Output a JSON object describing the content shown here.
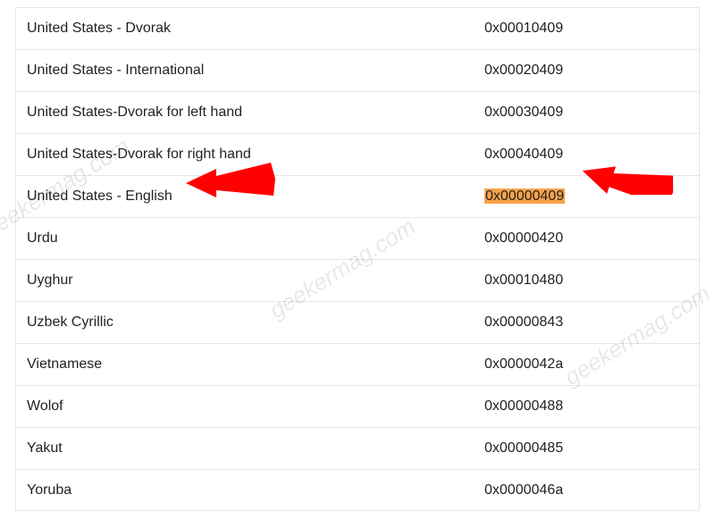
{
  "table": {
    "rows": [
      {
        "name": "United States - Dvorak",
        "code": "0x00010409",
        "highlighted": false
      },
      {
        "name": "United States - International",
        "code": "0x00020409",
        "highlighted": false
      },
      {
        "name": "United States-Dvorak for left hand",
        "code": "0x00030409",
        "highlighted": false
      },
      {
        "name": "United States-Dvorak for right hand",
        "code": "0x00040409",
        "highlighted": false
      },
      {
        "name": "United States - English",
        "code": "0x00000409",
        "highlighted": true
      },
      {
        "name": "Urdu",
        "code": "0x00000420",
        "highlighted": false
      },
      {
        "name": "Uyghur",
        "code": "0x00010480",
        "highlighted": false
      },
      {
        "name": "Uzbek Cyrillic",
        "code": "0x00000843",
        "highlighted": false
      },
      {
        "name": "Vietnamese",
        "code": "0x0000042a",
        "highlighted": false
      },
      {
        "name": "Wolof",
        "code": "0x00000488",
        "highlighted": false
      },
      {
        "name": "Yakut",
        "code": "0x00000485",
        "highlighted": false
      },
      {
        "name": "Yoruba",
        "code": "0x0000046a",
        "highlighted": false
      }
    ]
  },
  "watermark_text": "geekermag.com",
  "arrow_color": "#ff0000",
  "highlight_color": "#f7a24a"
}
